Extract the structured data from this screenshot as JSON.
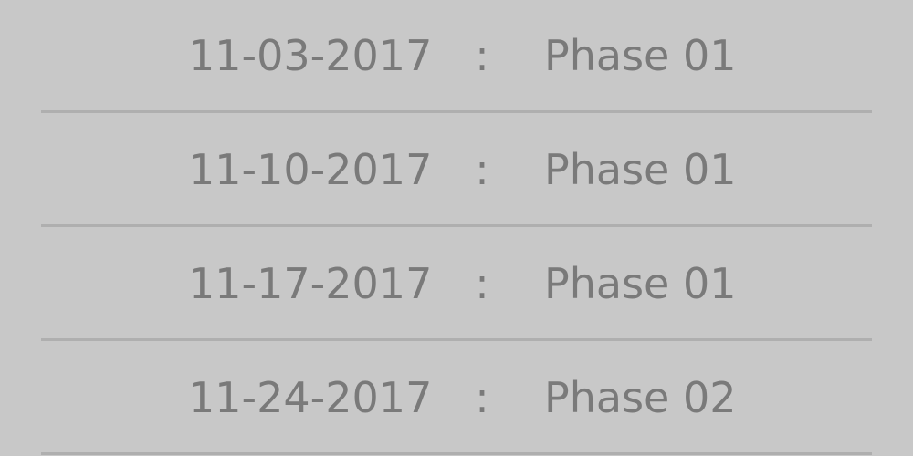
{
  "schedule": {
    "separator": ":",
    "rows": [
      {
        "date": "11-03-2017",
        "phase": "Phase 01"
      },
      {
        "date": "11-10-2017",
        "phase": "Phase 01"
      },
      {
        "date": "11-17-2017",
        "phase": "Phase 01"
      },
      {
        "date": "11-24-2017",
        "phase": "Phase 02"
      }
    ]
  },
  "colors": {
    "background": "#c8c8c8",
    "text": "#7a7a7a",
    "divider": "#afafaf"
  }
}
